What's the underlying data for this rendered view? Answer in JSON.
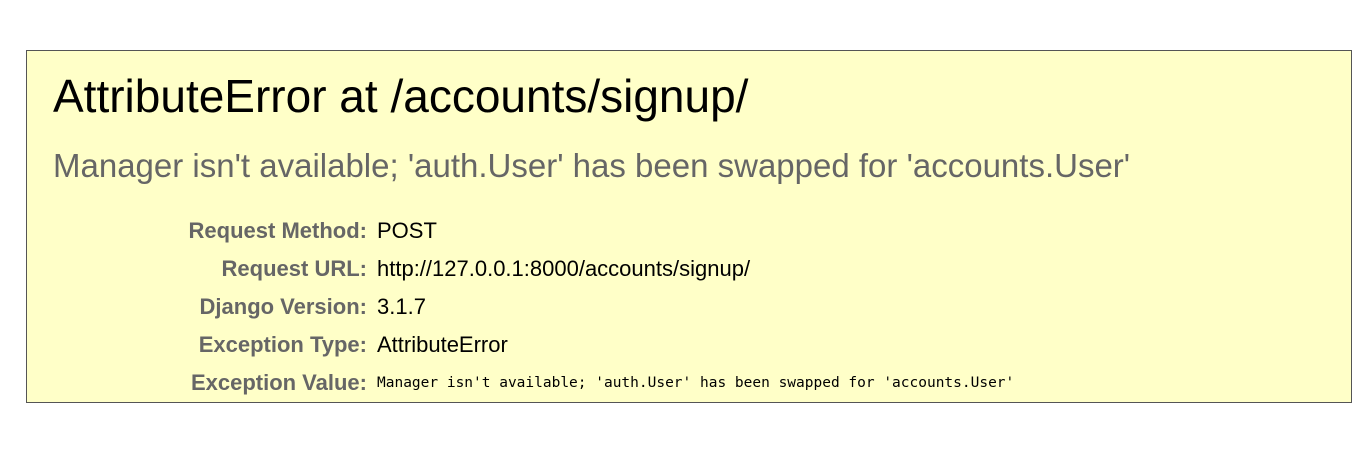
{
  "summary": {
    "title": "AttributeError at /accounts/signup/",
    "exception_message": "Manager isn't available; 'auth.User' has been swapped for 'accounts.User'",
    "meta": [
      {
        "label": "Request Method:",
        "value": "POST"
      },
      {
        "label": "Request URL:",
        "value": "http://127.0.0.1:8000/accounts/signup/"
      },
      {
        "label": "Django Version:",
        "value": "3.1.7"
      },
      {
        "label": "Exception Type:",
        "value": "AttributeError"
      },
      {
        "label": "Exception Value:",
        "value": "Manager isn't available; 'auth.User' has been swapped for 'accounts.User'"
      }
    ]
  },
  "colors": {
    "panel_background": "#ffffc8",
    "panel_border": "#555555",
    "label_text": "#666666"
  }
}
